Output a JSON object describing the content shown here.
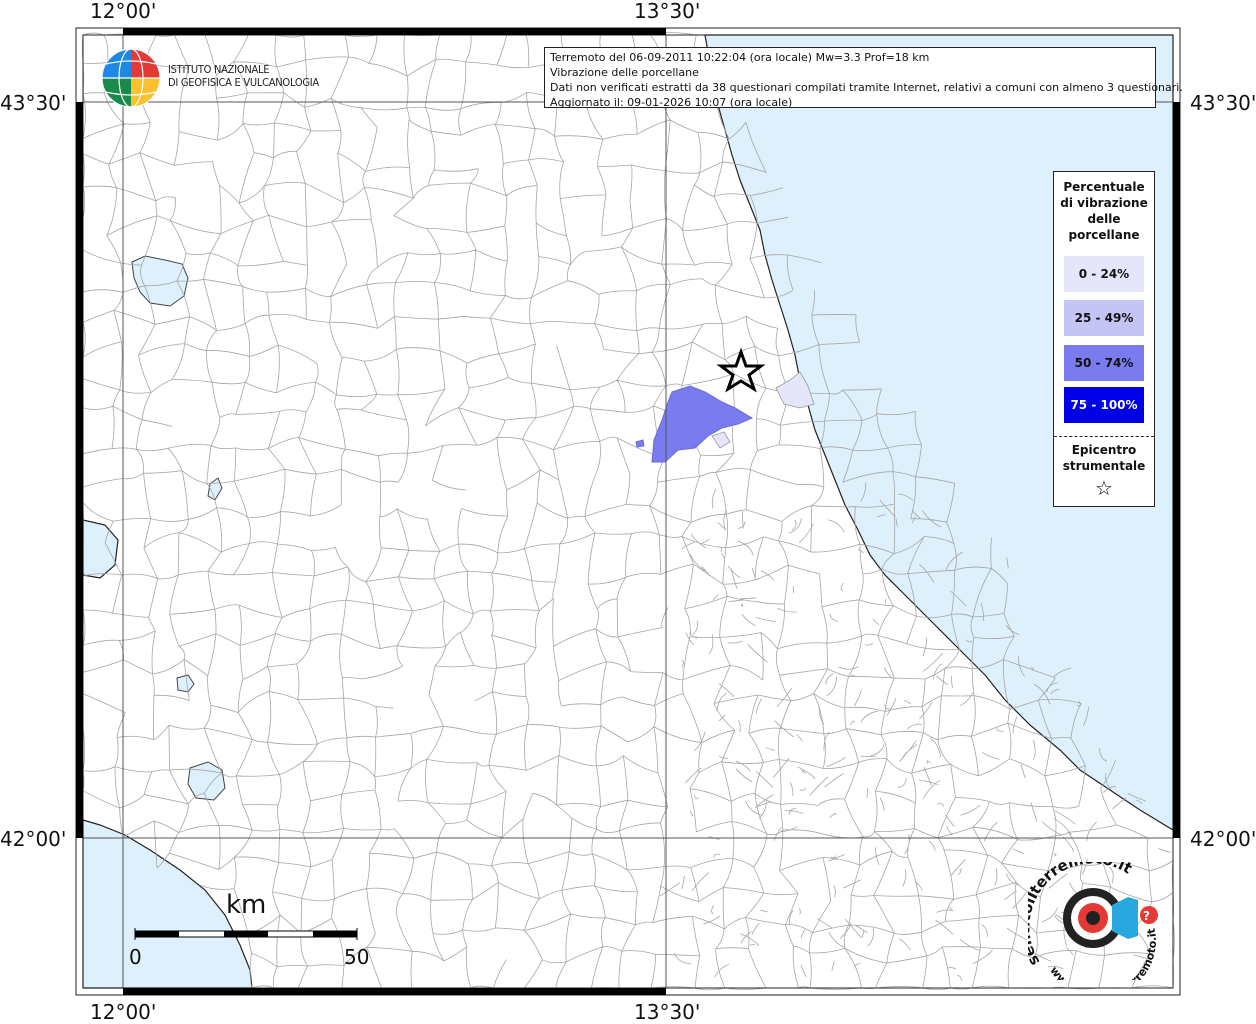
{
  "header": {
    "line1": "Terremoto del 06-09-2011 10:22:04 (ora locale) Mw=3.3 Prof=18 km",
    "line2": "Vibrazione delle porcellane",
    "line3": "Dati non verificati estratti da 38 questionari compilati tramite Internet, relativi a comuni con almeno 3 questionari.",
    "line4": "Aggiornato il: 09-01-2026 10:07 (ora locale)"
  },
  "logo": {
    "line1": "ISTITUTO NAZIONALE",
    "line2": "DI GEOFISICA E VULCANOLOGIA"
  },
  "coordinates": {
    "top_left": "12°00'",
    "top_right": "13°30'",
    "bottom_left": "12°00'",
    "bottom_right": "13°30'",
    "left_upper": "43°30'",
    "left_lower": "42°00'",
    "right_upper": "43°30'",
    "right_lower": "42°00'"
  },
  "legend": {
    "title_line1": "Percentuale",
    "title_line2": "di vibrazione",
    "title_line3": "delle",
    "title_line4": "porcellane",
    "items": [
      {
        "label": "0 - 24%",
        "color": "#e6e6fa",
        "text_color": "#111111"
      },
      {
        "label": "25 - 49%",
        "color": "#c4c4f5",
        "text_color": "#111111"
      },
      {
        "label": "50 - 74%",
        "color": "#7b7bf0",
        "text_color": "#111111"
      },
      {
        "label": "75 - 100%",
        "color": "#0000e6",
        "text_color": "#ffffff"
      }
    ],
    "epicentre_line1": "Epicentro",
    "epicentre_line2": "strumentale",
    "epicentre_symbol": "☆"
  },
  "scale": {
    "unit": "km",
    "start": "0",
    "end": "50"
  },
  "watermark": {
    "text_top": "sentitoilterremoto.it",
    "text_bottom": "www.sentitoilterremoto.it",
    "question": "?"
  },
  "colors": {
    "sea": "#ddf0fb",
    "lake": "#ddf0fb",
    "land": "#ffffff",
    "border": "#9a9a9a"
  }
}
